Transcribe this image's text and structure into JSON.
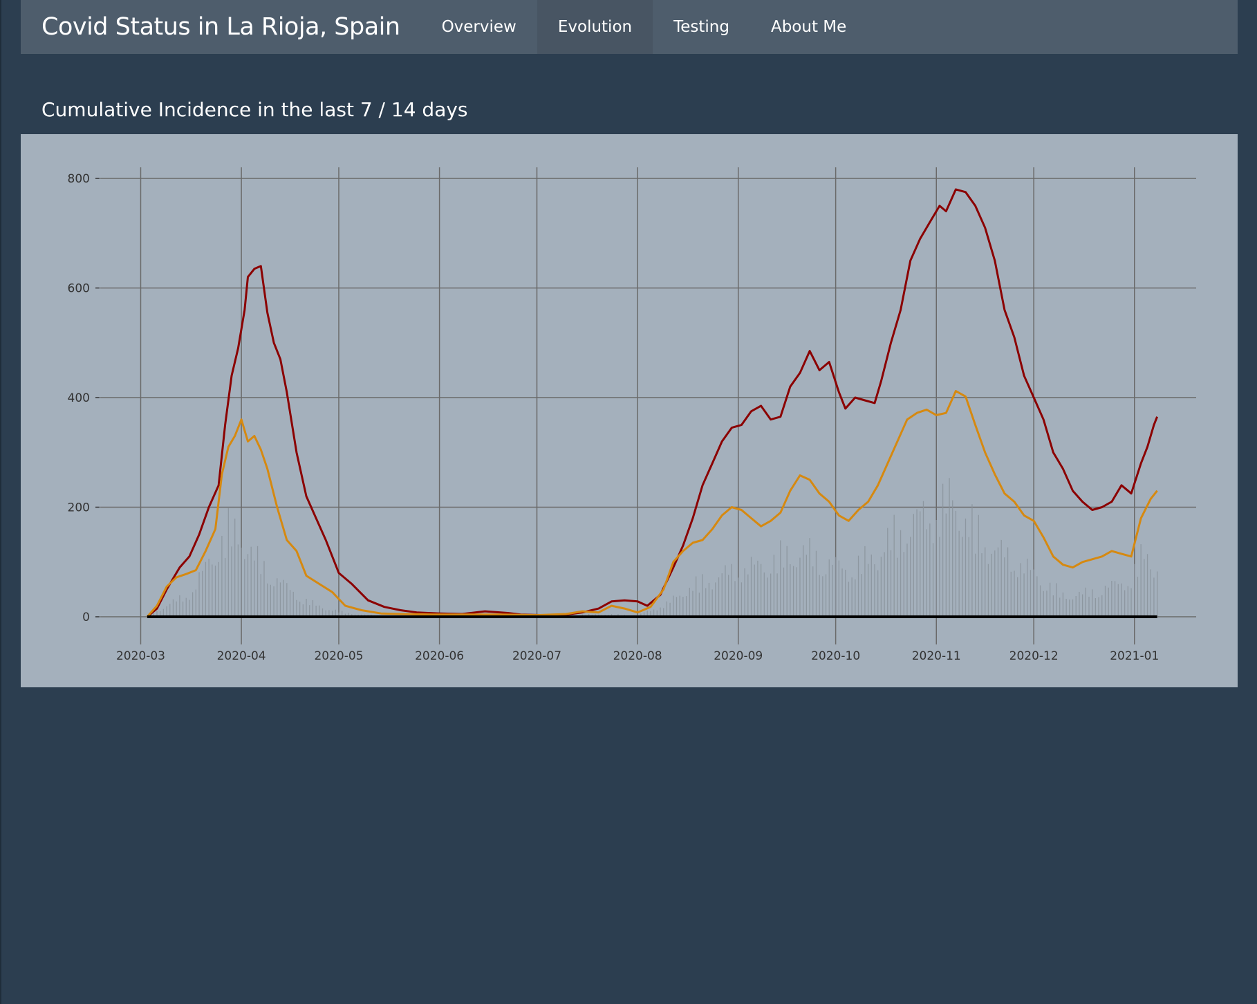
{
  "app": {
    "title": "Covid Status in La Rioja, Spain"
  },
  "nav": {
    "items": [
      {
        "label": "Overview",
        "active": false
      },
      {
        "label": "Evolution",
        "active": true
      },
      {
        "label": "Testing",
        "active": false
      },
      {
        "label": "About Me",
        "active": false
      }
    ]
  },
  "section": {
    "title": "Cumulative Incidence in the last 7 / 14 days"
  },
  "colors": {
    "background": "#2c3e50",
    "navbar": "#4e5d6c",
    "panel": "#a4b0bc",
    "series_14d": "#8b0000",
    "series_7d": "#d68910",
    "bars": "#8a939c",
    "grid": "#6a6a6a"
  },
  "chart_data": {
    "type": "line",
    "title": "",
    "xlabel": "",
    "ylabel": "",
    "ylim": [
      0,
      800
    ],
    "yticks": [
      0,
      200,
      400,
      600,
      800
    ],
    "xlim": [
      "2020-02-25",
      "2021-01-20"
    ],
    "xticks": [
      "2020-03",
      "2020-04",
      "2020-05",
      "2020-06",
      "2020-07",
      "2020-08",
      "2020-09",
      "2020-10",
      "2020-11",
      "2020-12",
      "2021-01"
    ],
    "grid": true,
    "legend": "none",
    "series": [
      {
        "id": "ci_14d",
        "color": "#8b0000",
        "points": [
          [
            "2020-03-03",
            0
          ],
          [
            "2020-03-06",
            15
          ],
          [
            "2020-03-09",
            50
          ],
          [
            "2020-03-13",
            90
          ],
          [
            "2020-03-16",
            110
          ],
          [
            "2020-03-19",
            150
          ],
          [
            "2020-03-22",
            200
          ],
          [
            "2020-03-25",
            240
          ],
          [
            "2020-03-27",
            350
          ],
          [
            "2020-03-29",
            440
          ],
          [
            "2020-03-31",
            490
          ],
          [
            "2020-04-02",
            560
          ],
          [
            "2020-04-03",
            620
          ],
          [
            "2020-04-05",
            635
          ],
          [
            "2020-04-07",
            640
          ],
          [
            "2020-04-09",
            555
          ],
          [
            "2020-04-11",
            500
          ],
          [
            "2020-04-13",
            470
          ],
          [
            "2020-04-15",
            410
          ],
          [
            "2020-04-18",
            300
          ],
          [
            "2020-04-21",
            220
          ],
          [
            "2020-04-24",
            180
          ],
          [
            "2020-04-27",
            140
          ],
          [
            "2020-05-01",
            80
          ],
          [
            "2020-05-05",
            60
          ],
          [
            "2020-05-10",
            30
          ],
          [
            "2020-05-15",
            18
          ],
          [
            "2020-05-20",
            12
          ],
          [
            "2020-05-25",
            8
          ],
          [
            "2020-06-01",
            6
          ],
          [
            "2020-06-08",
            5
          ],
          [
            "2020-06-15",
            10
          ],
          [
            "2020-06-22",
            7
          ],
          [
            "2020-06-26",
            4
          ],
          [
            "2020-07-03",
            3
          ],
          [
            "2020-07-10",
            4
          ],
          [
            "2020-07-15",
            8
          ],
          [
            "2020-07-20",
            15
          ],
          [
            "2020-07-24",
            28
          ],
          [
            "2020-07-28",
            30
          ],
          [
            "2020-08-01",
            28
          ],
          [
            "2020-08-04",
            20
          ],
          [
            "2020-08-08",
            40
          ],
          [
            "2020-08-12",
            90
          ],
          [
            "2020-08-15",
            130
          ],
          [
            "2020-08-18",
            180
          ],
          [
            "2020-08-21",
            240
          ],
          [
            "2020-08-24",
            280
          ],
          [
            "2020-08-27",
            320
          ],
          [
            "2020-08-30",
            345
          ],
          [
            "2020-09-02",
            350
          ],
          [
            "2020-09-05",
            375
          ],
          [
            "2020-09-08",
            385
          ],
          [
            "2020-09-11",
            360
          ],
          [
            "2020-09-14",
            365
          ],
          [
            "2020-09-17",
            420
          ],
          [
            "2020-09-20",
            445
          ],
          [
            "2020-09-23",
            485
          ],
          [
            "2020-09-26",
            450
          ],
          [
            "2020-09-29",
            465
          ],
          [
            "2020-10-02",
            410
          ],
          [
            "2020-10-04",
            380
          ],
          [
            "2020-10-07",
            400
          ],
          [
            "2020-10-10",
            395
          ],
          [
            "2020-10-13",
            390
          ],
          [
            "2020-10-15",
            430
          ],
          [
            "2020-10-18",
            500
          ],
          [
            "2020-10-21",
            560
          ],
          [
            "2020-10-24",
            650
          ],
          [
            "2020-10-27",
            690
          ],
          [
            "2020-10-30",
            720
          ],
          [
            "2020-11-02",
            750
          ],
          [
            "2020-11-04",
            740
          ],
          [
            "2020-11-07",
            780
          ],
          [
            "2020-11-10",
            775
          ],
          [
            "2020-11-13",
            750
          ],
          [
            "2020-11-16",
            710
          ],
          [
            "2020-11-19",
            650
          ],
          [
            "2020-11-22",
            560
          ],
          [
            "2020-11-25",
            510
          ],
          [
            "2020-11-28",
            440
          ],
          [
            "2020-12-01",
            400
          ],
          [
            "2020-12-04",
            360
          ],
          [
            "2020-12-07",
            300
          ],
          [
            "2020-12-10",
            270
          ],
          [
            "2020-12-13",
            230
          ],
          [
            "2020-12-16",
            210
          ],
          [
            "2020-12-19",
            195
          ],
          [
            "2020-12-22",
            200
          ],
          [
            "2020-12-25",
            210
          ],
          [
            "2020-12-28",
            240
          ],
          [
            "2020-12-31",
            225
          ],
          [
            "2021-01-03",
            280
          ],
          [
            "2021-01-05",
            310
          ],
          [
            "2021-01-07",
            350
          ],
          [
            "2021-01-08",
            365
          ]
        ]
      },
      {
        "id": "ci_7d",
        "color": "#d68910",
        "points": [
          [
            "2020-03-03",
            0
          ],
          [
            "2020-03-06",
            20
          ],
          [
            "2020-03-09",
            55
          ],
          [
            "2020-03-12",
            72
          ],
          [
            "2020-03-15",
            78
          ],
          [
            "2020-03-18",
            85
          ],
          [
            "2020-03-21",
            120
          ],
          [
            "2020-03-24",
            160
          ],
          [
            "2020-03-26",
            260
          ],
          [
            "2020-03-28",
            310
          ],
          [
            "2020-03-30",
            330
          ],
          [
            "2020-04-01",
            360
          ],
          [
            "2020-04-03",
            320
          ],
          [
            "2020-04-05",
            330
          ],
          [
            "2020-04-07",
            305
          ],
          [
            "2020-04-09",
            270
          ],
          [
            "2020-04-12",
            200
          ],
          [
            "2020-04-15",
            140
          ],
          [
            "2020-04-18",
            120
          ],
          [
            "2020-04-21",
            75
          ],
          [
            "2020-04-25",
            60
          ],
          [
            "2020-04-29",
            45
          ],
          [
            "2020-05-03",
            20
          ],
          [
            "2020-05-08",
            12
          ],
          [
            "2020-05-14",
            6
          ],
          [
            "2020-05-20",
            5
          ],
          [
            "2020-05-30",
            4
          ],
          [
            "2020-06-10",
            4
          ],
          [
            "2020-06-20",
            4
          ],
          [
            "2020-07-01",
            3
          ],
          [
            "2020-07-10",
            5
          ],
          [
            "2020-07-15",
            10
          ],
          [
            "2020-07-20",
            8
          ],
          [
            "2020-07-24",
            20
          ],
          [
            "2020-07-28",
            15
          ],
          [
            "2020-08-01",
            8
          ],
          [
            "2020-08-05",
            18
          ],
          [
            "2020-08-09",
            50
          ],
          [
            "2020-08-12",
            100
          ],
          [
            "2020-08-15",
            120
          ],
          [
            "2020-08-18",
            135
          ],
          [
            "2020-08-21",
            140
          ],
          [
            "2020-08-24",
            160
          ],
          [
            "2020-08-27",
            185
          ],
          [
            "2020-08-30",
            200
          ],
          [
            "2020-09-02",
            195
          ],
          [
            "2020-09-05",
            180
          ],
          [
            "2020-09-08",
            165
          ],
          [
            "2020-09-11",
            175
          ],
          [
            "2020-09-14",
            190
          ],
          [
            "2020-09-17",
            230
          ],
          [
            "2020-09-20",
            258
          ],
          [
            "2020-09-23",
            250
          ],
          [
            "2020-09-26",
            225
          ],
          [
            "2020-09-29",
            210
          ],
          [
            "2020-10-02",
            185
          ],
          [
            "2020-10-05",
            175
          ],
          [
            "2020-10-08",
            195
          ],
          [
            "2020-10-11",
            210
          ],
          [
            "2020-10-14",
            240
          ],
          [
            "2020-10-17",
            280
          ],
          [
            "2020-10-20",
            320
          ],
          [
            "2020-10-23",
            360
          ],
          [
            "2020-10-26",
            372
          ],
          [
            "2020-10-29",
            378
          ],
          [
            "2020-11-01",
            368
          ],
          [
            "2020-11-04",
            372
          ],
          [
            "2020-11-07",
            412
          ],
          [
            "2020-11-10",
            402
          ],
          [
            "2020-11-13",
            350
          ],
          [
            "2020-11-16",
            300
          ],
          [
            "2020-11-19",
            260
          ],
          [
            "2020-11-22",
            225
          ],
          [
            "2020-11-25",
            210
          ],
          [
            "2020-11-28",
            185
          ],
          [
            "2020-12-01",
            175
          ],
          [
            "2020-12-04",
            145
          ],
          [
            "2020-12-07",
            110
          ],
          [
            "2020-12-10",
            95
          ],
          [
            "2020-12-13",
            90
          ],
          [
            "2020-12-16",
            100
          ],
          [
            "2020-12-19",
            105
          ],
          [
            "2020-12-22",
            110
          ],
          [
            "2020-12-25",
            120
          ],
          [
            "2020-12-28",
            115
          ],
          [
            "2020-12-31",
            110
          ],
          [
            "2021-01-03",
            180
          ],
          [
            "2021-01-06",
            215
          ],
          [
            "2021-01-08",
            230
          ]
        ]
      }
    ],
    "daily_bars_note": "thin grey bars under curves: daily new cases per 100k (approximate envelope)",
    "daily_bars": [
      [
        "2020-03-03",
        2
      ],
      [
        "2020-03-10",
        30
      ],
      [
        "2020-03-17",
        60
      ],
      [
        "2020-03-24",
        160
      ],
      [
        "2020-03-28",
        200
      ],
      [
        "2020-04-01",
        195
      ],
      [
        "2020-04-05",
        140
      ],
      [
        "2020-04-10",
        100
      ],
      [
        "2020-04-15",
        70
      ],
      [
        "2020-04-20",
        40
      ],
      [
        "2020-04-25",
        25
      ],
      [
        "2020-05-01",
        12
      ],
      [
        "2020-05-08",
        5
      ],
      [
        "2020-05-20",
        2
      ],
      [
        "2020-06-10",
        1
      ],
      [
        "2020-07-01",
        1
      ],
      [
        "2020-07-20",
        6
      ],
      [
        "2020-08-01",
        4
      ],
      [
        "2020-08-10",
        30
      ],
      [
        "2020-08-17",
        70
      ],
      [
        "2020-08-24",
        90
      ],
      [
        "2020-08-31",
        110
      ],
      [
        "2020-09-07",
        120
      ],
      [
        "2020-09-14",
        140
      ],
      [
        "2020-09-21",
        155
      ],
      [
        "2020-09-28",
        130
      ],
      [
        "2020-10-05",
        110
      ],
      [
        "2020-10-12",
        140
      ],
      [
        "2020-10-19",
        190
      ],
      [
        "2020-10-26",
        230
      ],
      [
        "2020-11-02",
        250
      ],
      [
        "2020-11-06",
        280
      ],
      [
        "2020-11-12",
        210
      ],
      [
        "2020-11-19",
        160
      ],
      [
        "2020-11-26",
        130
      ],
      [
        "2020-12-03",
        90
      ],
      [
        "2020-12-10",
        50
      ],
      [
        "2020-12-17",
        55
      ],
      [
        "2020-12-24",
        70
      ],
      [
        "2020-12-31",
        90
      ],
      [
        "2021-01-04",
        150
      ],
      [
        "2021-01-08",
        120
      ]
    ]
  }
}
